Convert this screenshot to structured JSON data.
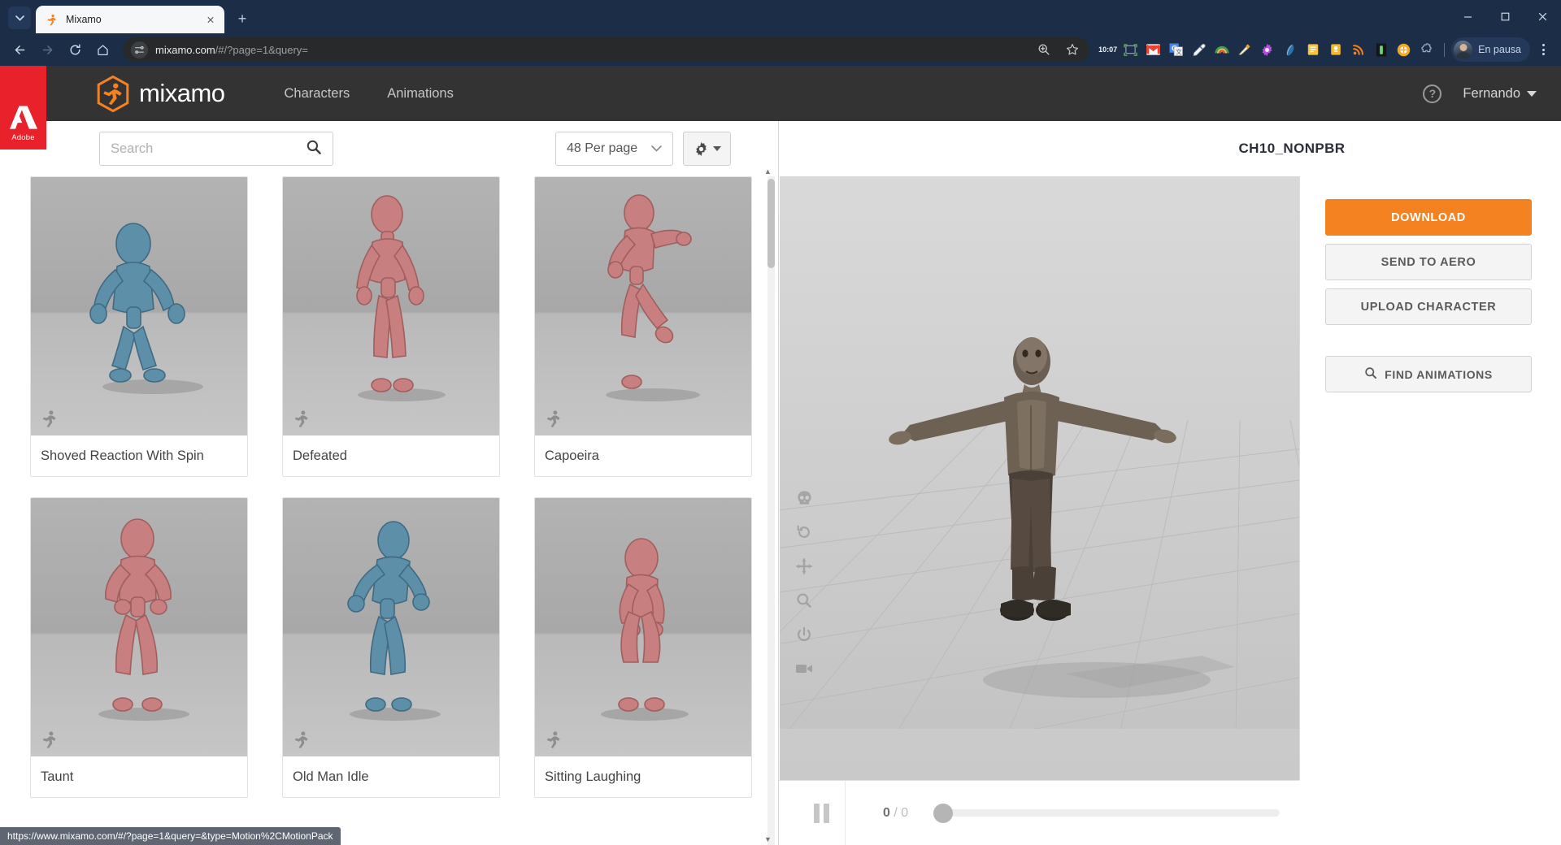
{
  "browser": {
    "tab": {
      "title": "Mixamo",
      "favicon": "mixamo-runner-icon",
      "close": "✕"
    },
    "tab_list_icon": "chevron-down-icon",
    "new_tab_icon": "+",
    "window_controls": {
      "minimize": "—",
      "maximize": "❐",
      "close": "✕"
    },
    "nav": {
      "back": "←",
      "forward": "→",
      "reload": "⟳",
      "home": "⌂"
    },
    "omnibox": {
      "url_strong": "mixamo.com",
      "url_rest": "/#/?page=1&query=",
      "site_info_icon": "tune-icon",
      "zoom_icon": "zoom-magnifier-icon",
      "bookmark_icon": "star-icon"
    },
    "extensions": [
      {
        "name": "timer-extension",
        "label": "10:07"
      },
      {
        "name": "screenshot-extension",
        "label": ""
      },
      {
        "name": "gmail-extension",
        "label": "M"
      },
      {
        "name": "google-translate-extension",
        "label": "G"
      },
      {
        "name": "eyedropper-extension",
        "label": ""
      },
      {
        "name": "rainbow-extension",
        "label": ""
      },
      {
        "name": "paint-extension",
        "label": ""
      },
      {
        "name": "settings-gear-extension",
        "label": ""
      },
      {
        "name": "feather-extension",
        "label": ""
      },
      {
        "name": "note-extension",
        "label": ""
      },
      {
        "name": "bookmark-yellow-extension",
        "label": ""
      },
      {
        "name": "rss-extension",
        "label": ""
      },
      {
        "name": "battery-extension",
        "label": ""
      },
      {
        "name": "orange-circle-extension",
        "label": ""
      },
      {
        "name": "puzzle-extensions-icon",
        "label": ""
      }
    ],
    "profile": {
      "name": "En pausa",
      "avatar": "user-avatar"
    },
    "menu_icon": "kebab-menu-icon",
    "statusbar_url": "https://www.mixamo.com/#/?page=1&query=&type=Motion%2CMotionPack"
  },
  "adobe": {
    "label": "Adobe",
    "logo": "adobe-a-logo",
    "color": "#e8212b"
  },
  "header": {
    "brand": "mixamo",
    "logo_icon": "mixamo-hexagon-runner-icon",
    "nav": [
      {
        "label": "Characters",
        "name": "nav-characters"
      },
      {
        "label": "Animations",
        "name": "nav-animations"
      }
    ],
    "help_icon": "help-question-icon",
    "user": "Fernando",
    "user_caret": "chevron-down-icon",
    "accent": "#f58220",
    "bar_color": "#333333"
  },
  "filters": {
    "search_placeholder": "Search",
    "search_value": "",
    "search_icon": "search-icon",
    "per_page": "48 Per page",
    "per_page_caret": "chevron-down-icon",
    "gear_icon": "gear-icon",
    "gear_caret": "caret-down-icon"
  },
  "grid": {
    "cards": [
      {
        "label": "Shoved Reaction With Spin",
        "badge": "motion-runner-icon",
        "tint": "blue",
        "pose": "crouch"
      },
      {
        "label": "Defeated",
        "badge": "motion-runner-icon",
        "tint": "red",
        "pose": "stand"
      },
      {
        "label": "Capoeira",
        "badge": "motion-runner-icon",
        "tint": "red",
        "pose": "kick"
      },
      {
        "label": "Taunt",
        "badge": "motion-runner-icon",
        "tint": "red",
        "pose": "taunt"
      },
      {
        "label": "Old Man Idle",
        "badge": "motion-runner-icon",
        "tint": "blue",
        "pose": "idle"
      },
      {
        "label": "Sitting Laughing",
        "badge": "motion-runner-icon",
        "tint": "red",
        "pose": "sit"
      }
    ]
  },
  "viewer": {
    "title": "CH10_NONPBR",
    "model": "zombie-character-3d",
    "tools": [
      {
        "name": "skull-tool-icon"
      },
      {
        "name": "reset-rotate-tool-icon"
      },
      {
        "name": "move-tool-icon"
      },
      {
        "name": "zoom-tool-icon"
      },
      {
        "name": "power-tool-icon"
      },
      {
        "name": "camera-tool-icon"
      }
    ],
    "actions": [
      {
        "label": "DOWNLOAD",
        "name": "download-button",
        "style": "primary"
      },
      {
        "label": "SEND TO AERO",
        "name": "send-to-aero-button",
        "style": "default"
      },
      {
        "label": "UPLOAD CHARACTER",
        "name": "upload-character-button",
        "style": "default"
      }
    ],
    "find_animations": {
      "label": "FIND ANIMATIONS",
      "icon": "search-icon"
    },
    "player": {
      "pause_icon": "pause-icon",
      "frame_current": "0",
      "frame_sep": " / ",
      "frame_total": "0",
      "progress": 0
    }
  }
}
